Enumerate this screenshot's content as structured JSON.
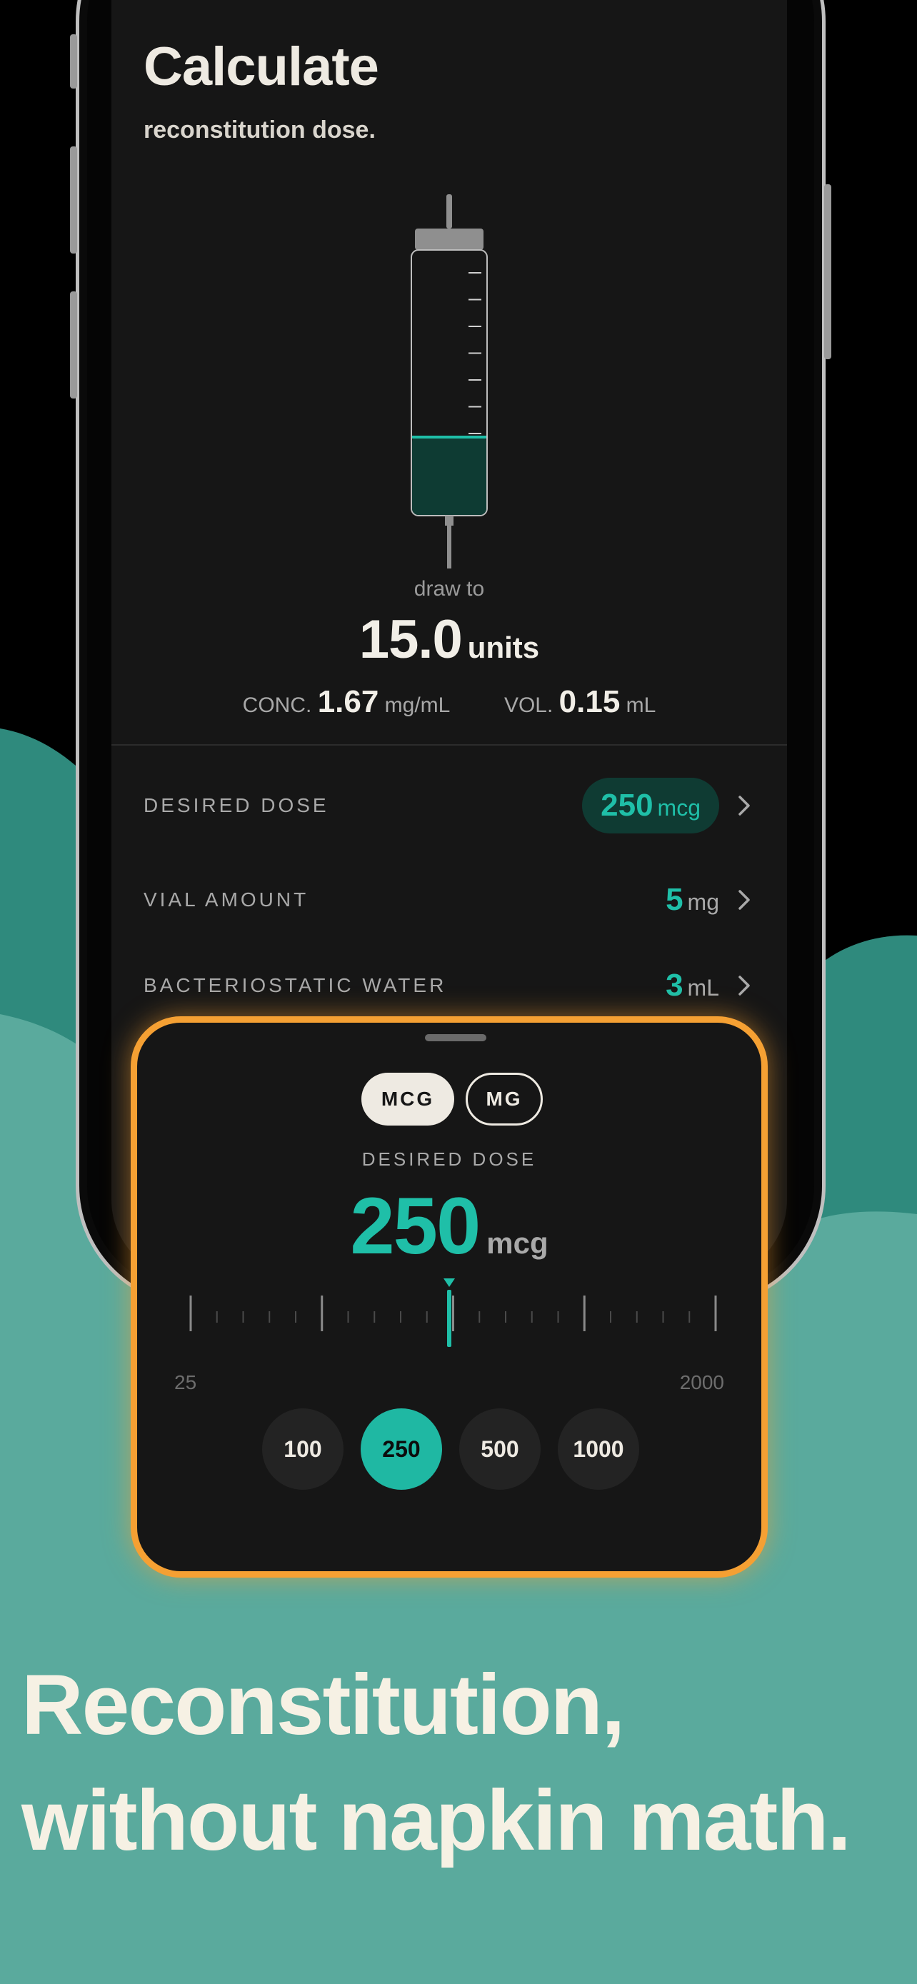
{
  "colors": {
    "accent": "#1fbfa8",
    "sheet_border": "#f5a033",
    "wave_dark": "#2f8a7d",
    "wave_light": "#5aaa9d",
    "headline_text": "#f6f1e4"
  },
  "screen": {
    "title": "Calculate",
    "subtitle": "reconstitution dose.",
    "syringe_fill_fraction": 0.3,
    "draw_to_label": "draw to",
    "draw_value": "15.0",
    "draw_unit": "units",
    "conc_label": "CONC.",
    "conc_value": "1.67",
    "conc_unit": "mg/mL",
    "vol_label": "VOL.",
    "vol_value": "0.15",
    "vol_unit": "mL",
    "rows": [
      {
        "label": "DESIRED DOSE",
        "value": "250",
        "unit": "mcg"
      },
      {
        "label": "VIAL AMOUNT",
        "value": "5",
        "unit": "mg"
      },
      {
        "label": "BACTERIOSTATIC WATER",
        "value": "3",
        "unit": "mL"
      }
    ]
  },
  "sheet": {
    "unit_options": [
      "MCG",
      "MG"
    ],
    "selected_unit": "MCG",
    "label": "DESIRED DOSE",
    "value": "250",
    "unit": "mcg",
    "range_min": "25",
    "range_max": "2000",
    "presets": [
      "100",
      "250",
      "500",
      "1000"
    ],
    "selected_preset": "250"
  },
  "headline": {
    "line1": "Reconstitution,",
    "line2": "without napkin math."
  }
}
